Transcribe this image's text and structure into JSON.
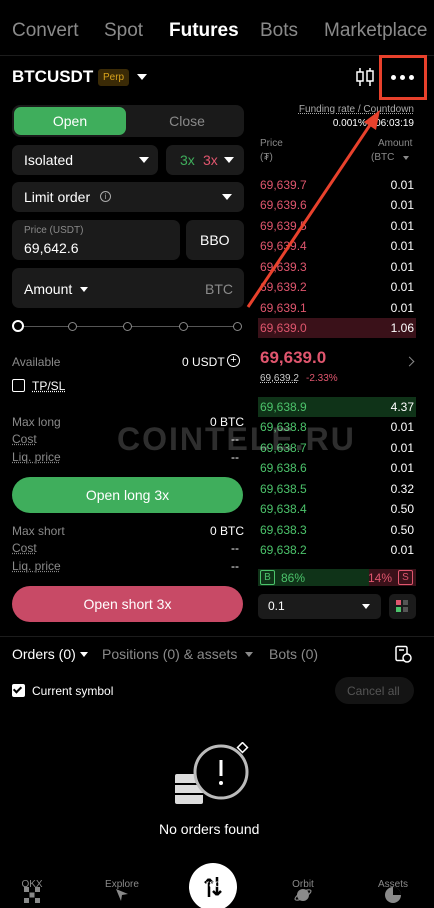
{
  "tabs": [
    "Convert",
    "Spot",
    "Futures",
    "Bots",
    "Marketplace"
  ],
  "symbol": {
    "name": "BTCUSDT",
    "badge": "Perp"
  },
  "funding": {
    "label": "Funding rate / Countdown",
    "value": "0.001% / 06:03:19"
  },
  "order_panel": {
    "open_label": "Open",
    "close_label": "Close",
    "margin_mode": "Isolated",
    "leverage_long": "3x",
    "leverage_short": "3x",
    "order_type": "Limit order",
    "price_label": "Price (USDT)",
    "price_value": "69,642.6",
    "bbo_label": "BBO",
    "amount_label": "Amount",
    "amount_unit": "BTC",
    "available_label": "Available",
    "available_value": "0 USDT",
    "tpsl_label": "TP/SL",
    "max_long_label": "Max long",
    "max_long_value": "0 BTC",
    "cost_label": "Cost",
    "cost_value_long": "--",
    "liq_label": "Liq. price",
    "liq_value_long": "--",
    "open_long_label": "Open long 3x",
    "max_short_label": "Max short",
    "max_short_value": "0 BTC",
    "cost_value_short": "--",
    "liq_value_short": "--",
    "open_short_label": "Open short 3x"
  },
  "order_book": {
    "price_header": "Price",
    "price_unit": "(₮)",
    "amount_header": "Amount",
    "amount_unit": "(BTC",
    "asks": [
      {
        "price": "69,639.7",
        "amount": "0.01"
      },
      {
        "price": "69,639.6",
        "amount": "0.01"
      },
      {
        "price": "69,639.5",
        "amount": "0.01"
      },
      {
        "price": "69,639.4",
        "amount": "0.01"
      },
      {
        "price": "69,639.3",
        "amount": "0.01"
      },
      {
        "price": "69,639.2",
        "amount": "0.01"
      },
      {
        "price": "69,639.1",
        "amount": "0.01"
      },
      {
        "price": "69,639.0",
        "amount": "1.06"
      }
    ],
    "last_price": "69,639.0",
    "mark_price": "69,639.2",
    "change": "-2.33%",
    "bids": [
      {
        "price": "69,638.9",
        "amount": "4.37"
      },
      {
        "price": "69,638.8",
        "amount": "0.01"
      },
      {
        "price": "69,638.7",
        "amount": "0.01"
      },
      {
        "price": "69,638.6",
        "amount": "0.01"
      },
      {
        "price": "69,638.5",
        "amount": "0.32"
      },
      {
        "price": "69,638.4",
        "amount": "0.50"
      },
      {
        "price": "69,638.3",
        "amount": "0.50"
      },
      {
        "price": "69,638.2",
        "amount": "0.01"
      }
    ],
    "buy_tag": "B",
    "buy_pct": "86%",
    "sell_pct": "14%",
    "sell_tag": "S",
    "depth_value": "0.1"
  },
  "bottom_tabs": {
    "orders": "Orders (0)",
    "positions": "Positions (0) & assets",
    "bots": "Bots (0)"
  },
  "current_symbol_label": "Current symbol",
  "cancel_all_label": "Cancel all",
  "empty_text": "No orders found",
  "watermark": "COINTELE.RU",
  "nav": [
    "OKX",
    "Explore",
    "Trade",
    "Orbit",
    "Assets"
  ],
  "colors": {
    "green": "#3fae5c",
    "red": "#c84a66",
    "ask": "#e0566e",
    "bid": "#4cc36b",
    "highlight": "#e8412c"
  }
}
